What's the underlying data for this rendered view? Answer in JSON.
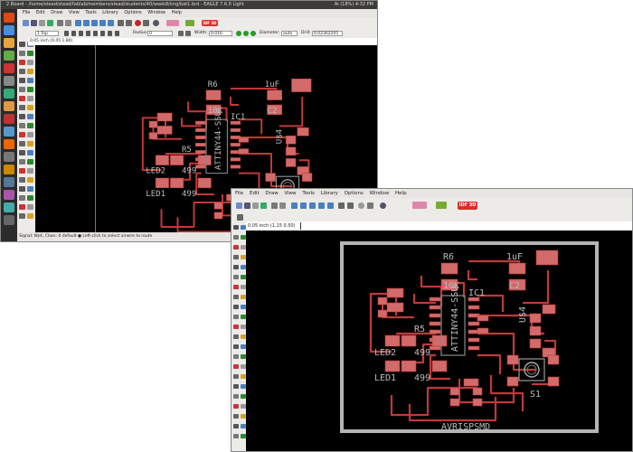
{
  "window1": {
    "title": "2 Board - /home/stead/stead/fablab/members/stead/students/40/week8/img/bat1.brd - EAGLE 7.6.0 Light",
    "menu": [
      "File",
      "Edit",
      "Draw",
      "View",
      "Tools",
      "Library",
      "Options",
      "Window",
      "Help"
    ],
    "layer_select": "1 Top",
    "radius_label": "Radius:",
    "radius_value": "0",
    "width_label": "Width:",
    "width_value": "0.016",
    "diameter_label": "Diameter:",
    "diameter_value": "auto",
    "drill_label": "Drill:",
    "drill_value": "0.02362205",
    "coordinate": "0.05 inch (0.45 1.80)",
    "status": "Signal: N$4, Class: 0 default   ● Left-click to select airwire to route",
    "sys_tray": [
      "Ai",
      "(18%)",
      "4:32 PM"
    ],
    "badge": "IDF 3D"
  },
  "window2": {
    "menu": [
      "File",
      "Edit",
      "Draw",
      "View",
      "Tools",
      "Library",
      "Options",
      "Window",
      "Help"
    ],
    "coordinate": "0.05 inch (1.15 0.50)",
    "badge": "IDF 3D"
  },
  "board": {
    "labels": {
      "r6": "R6",
      "r6v": "10K",
      "c2t": "1uF",
      "c2": "C2",
      "ic1": "IC1",
      "ic_name": "ATTINY44-SSU",
      "u4": "U$4",
      "r5": "R5",
      "led2": "LED2",
      "led2v": "499",
      "led1": "LED1",
      "led1v": "499",
      "s1": "S1",
      "title": "AVRISPSMD"
    }
  },
  "colors": {
    "trace": "#c23838",
    "pad": "#d26a6a",
    "text": "#bbbbbb",
    "outline": "#b4b4b4",
    "canvas": "#000000"
  }
}
